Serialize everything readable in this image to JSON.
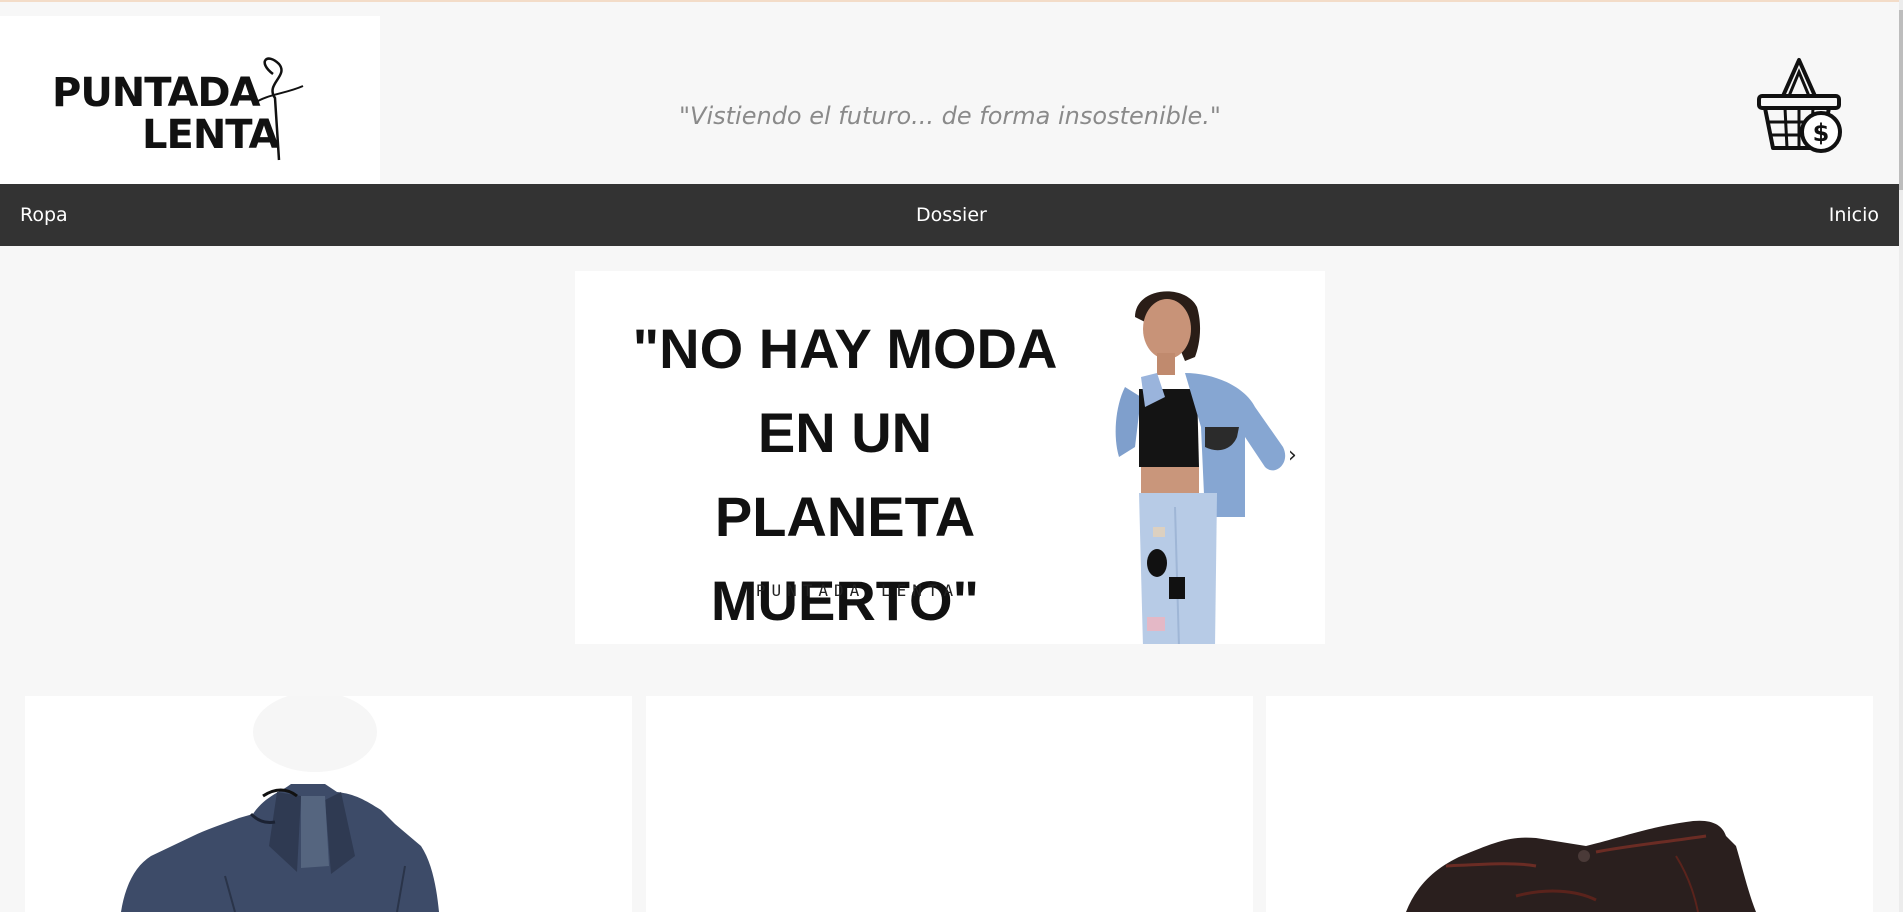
{
  "header": {
    "logo_line1": "PUNTADA",
    "logo_line2": "LENTA",
    "slogan": "\"Vistiendo el futuro... de forma insostenible.\"",
    "cart_icon": "shopping-basket-dollar-icon"
  },
  "nav": {
    "items": [
      {
        "label": "Ropa"
      },
      {
        "label": "Dossier"
      },
      {
        "label": "Inicio"
      }
    ]
  },
  "banner": {
    "quote_line1": "\"NO HAY MODA",
    "quote_line2": "EN UN",
    "quote_line3": "PLANETA MUERTO\"",
    "brand": "PUNTADA LENTA",
    "next_arrow": "›"
  },
  "products": [
    {
      "image": "denim-jacket-image"
    },
    {
      "image": "blank-product-image"
    },
    {
      "image": "dark-jeans-image"
    }
  ],
  "colors": {
    "nav_bg": "#333333",
    "page_bg": "#f7f7f7",
    "slogan": "#8a8a8a"
  }
}
